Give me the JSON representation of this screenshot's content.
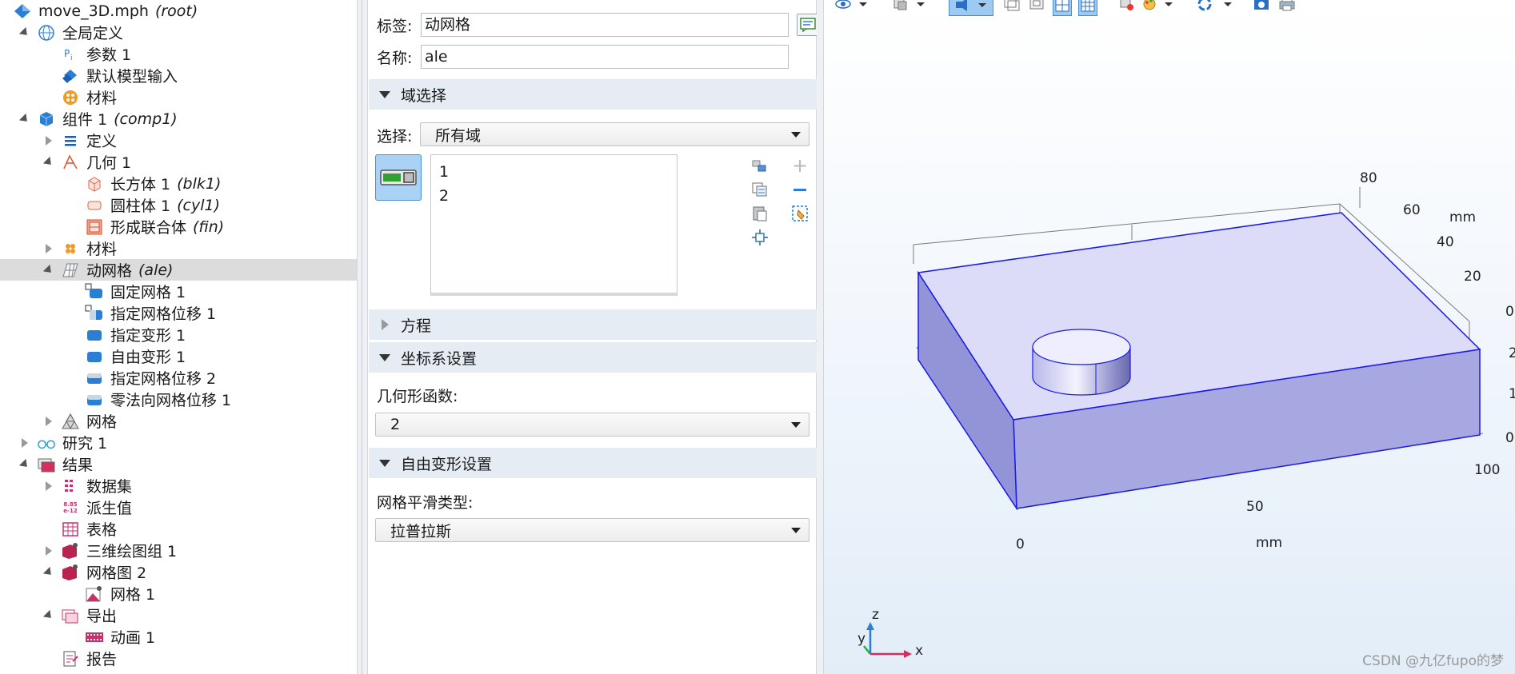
{
  "tree": [
    {
      "id": "file",
      "indent": 0,
      "expander": "none",
      "label": "move_3D.mph",
      "sub": "(root)",
      "icon": "comsol-file-icon"
    },
    {
      "id": "global-defs",
      "indent": 1,
      "expander": "open",
      "label": "全局定义",
      "sub": "",
      "icon": "globe-icon"
    },
    {
      "id": "params",
      "indent": 2,
      "expander": "none",
      "label": "参数 1",
      "sub": "",
      "icon": "parameters-icon"
    },
    {
      "id": "default-inputs",
      "indent": 2,
      "expander": "none",
      "label": "默认模型输入",
      "sub": "",
      "icon": "model-inputs-icon"
    },
    {
      "id": "global-materials",
      "indent": 2,
      "expander": "none",
      "label": "材料",
      "sub": "",
      "icon": "materials-icon"
    },
    {
      "id": "component",
      "indent": 1,
      "expander": "open",
      "label": "组件 1",
      "sub": "(comp1)",
      "icon": "component-cube-icon"
    },
    {
      "id": "definitions",
      "indent": 2,
      "expander": "closed",
      "label": "定义",
      "sub": "",
      "icon": "definitions-list-icon"
    },
    {
      "id": "geometry",
      "indent": 2,
      "expander": "open",
      "label": "几何 1",
      "sub": "",
      "icon": "geometry-icon"
    },
    {
      "id": "block",
      "indent": 3,
      "expander": "none",
      "label": "长方体 1",
      "sub": "(blk1)",
      "icon": "block-icon"
    },
    {
      "id": "cylinder",
      "indent": 3,
      "expander": "none",
      "label": "圆柱体 1",
      "sub": "(cyl1)",
      "icon": "cylinder-icon"
    },
    {
      "id": "form-union",
      "indent": 3,
      "expander": "none",
      "label": "形成联合体",
      "sub": "(fin)",
      "icon": "form-union-icon"
    },
    {
      "id": "materials",
      "indent": 2,
      "expander": "closed",
      "label": "材料",
      "sub": "",
      "icon": "materials-small-icon"
    },
    {
      "id": "moving-mesh",
      "indent": 2,
      "expander": "open",
      "label": "动网格",
      "sub": "(ale)",
      "icon": "moving-mesh-icon",
      "selected": true
    },
    {
      "id": "fixed-mesh",
      "indent": 3,
      "expander": "none",
      "label": "固定网格 1",
      "sub": "",
      "icon": "fixed-mesh-icon"
    },
    {
      "id": "prescribed-disp-1",
      "indent": 3,
      "expander": "none",
      "label": "指定网格位移 1",
      "sub": "",
      "icon": "prescribed-displacement-icon"
    },
    {
      "id": "prescribed-def",
      "indent": 3,
      "expander": "none",
      "label": "指定变形 1",
      "sub": "",
      "icon": "prescribed-deformation-icon"
    },
    {
      "id": "free-def",
      "indent": 3,
      "expander": "none",
      "label": "自由变形 1",
      "sub": "",
      "icon": "free-deformation-icon"
    },
    {
      "id": "prescribed-disp-2",
      "indent": 3,
      "expander": "none",
      "label": "指定网格位移 2",
      "sub": "",
      "icon": "boundary-displacement-icon"
    },
    {
      "id": "zero-normal",
      "indent": 3,
      "expander": "none",
      "label": "零法向网格位移 1",
      "sub": "",
      "icon": "zero-normal-displacement-icon"
    },
    {
      "id": "mesh",
      "indent": 2,
      "expander": "closed",
      "label": "网格",
      "sub": "",
      "icon": "mesh-triangle-icon"
    },
    {
      "id": "study",
      "indent": 1,
      "expander": "closed",
      "label": "研究 1",
      "sub": "",
      "icon": "study-icon"
    },
    {
      "id": "results",
      "indent": 1,
      "expander": "open",
      "label": "结果",
      "sub": "",
      "icon": "results-icon"
    },
    {
      "id": "datasets",
      "indent": 2,
      "expander": "closed",
      "label": "数据集",
      "sub": "",
      "icon": "datasets-icon"
    },
    {
      "id": "derived",
      "indent": 2,
      "expander": "none",
      "label": "派生值",
      "sub": "",
      "icon": "derived-values-icon",
      "glyph": "8.85\ne-12"
    },
    {
      "id": "tables",
      "indent": 2,
      "expander": "none",
      "label": "表格",
      "sub": "",
      "icon": "table-grid-icon"
    },
    {
      "id": "plot3d",
      "indent": 2,
      "expander": "closed",
      "label": "三维绘图组 1",
      "sub": "",
      "icon": "plot-group-3d-icon"
    },
    {
      "id": "mesh-plot",
      "indent": 2,
      "expander": "open",
      "label": "网格图 2",
      "sub": "",
      "icon": "mesh-plot-group-icon"
    },
    {
      "id": "mesh-plot-item",
      "indent": 3,
      "expander": "none",
      "label": "网格 1",
      "sub": "",
      "icon": "mesh-plot-icon"
    },
    {
      "id": "export",
      "indent": 2,
      "expander": "open",
      "label": "导出",
      "sub": "",
      "icon": "export-icon"
    },
    {
      "id": "animation",
      "indent": 3,
      "expander": "none",
      "label": "动画 1",
      "sub": "",
      "icon": "animation-film-icon"
    },
    {
      "id": "report",
      "indent": 2,
      "expander": "none",
      "label": "报告",
      "sub": "",
      "icon": "report-icon"
    }
  ],
  "settings": {
    "label_label": "标签:",
    "label_value": "动网格",
    "name_label": "名称:",
    "name_value": "ale",
    "domain_section": "域选择",
    "selection_label": "选择:",
    "selection_value": "所有域",
    "selection_items": [
      "1",
      "2"
    ],
    "equation_section": "方程",
    "coord_section": "坐标系设置",
    "shape_order_label": "几何形函数:",
    "shape_order_value": "2",
    "free_def_section": "自由变形设置",
    "smoothing_label": "网格平滑类型:",
    "smoothing_value": "拉普拉斯"
  },
  "graphics": {
    "x_ticks": [
      "0",
      "50",
      "100"
    ],
    "x_unit": "mm",
    "y_ticks": [
      "20",
      "40",
      "60",
      "80"
    ],
    "y_unit": "mm",
    "z_ticks": [
      "0",
      "2",
      "1",
      "0"
    ],
    "triad": {
      "x": "x",
      "y": "y",
      "z": "z"
    },
    "watermark": "CSDN @九亿fupo的梦"
  },
  "colors": {
    "selected_row": "#dcdcdc",
    "section_header": "#e6ecf4",
    "geometry_edge": "#1a1ae6",
    "geometry_top": "#dcdcf8",
    "geometry_front": "#a7a7e2",
    "geometry_side": "#9393d8"
  }
}
